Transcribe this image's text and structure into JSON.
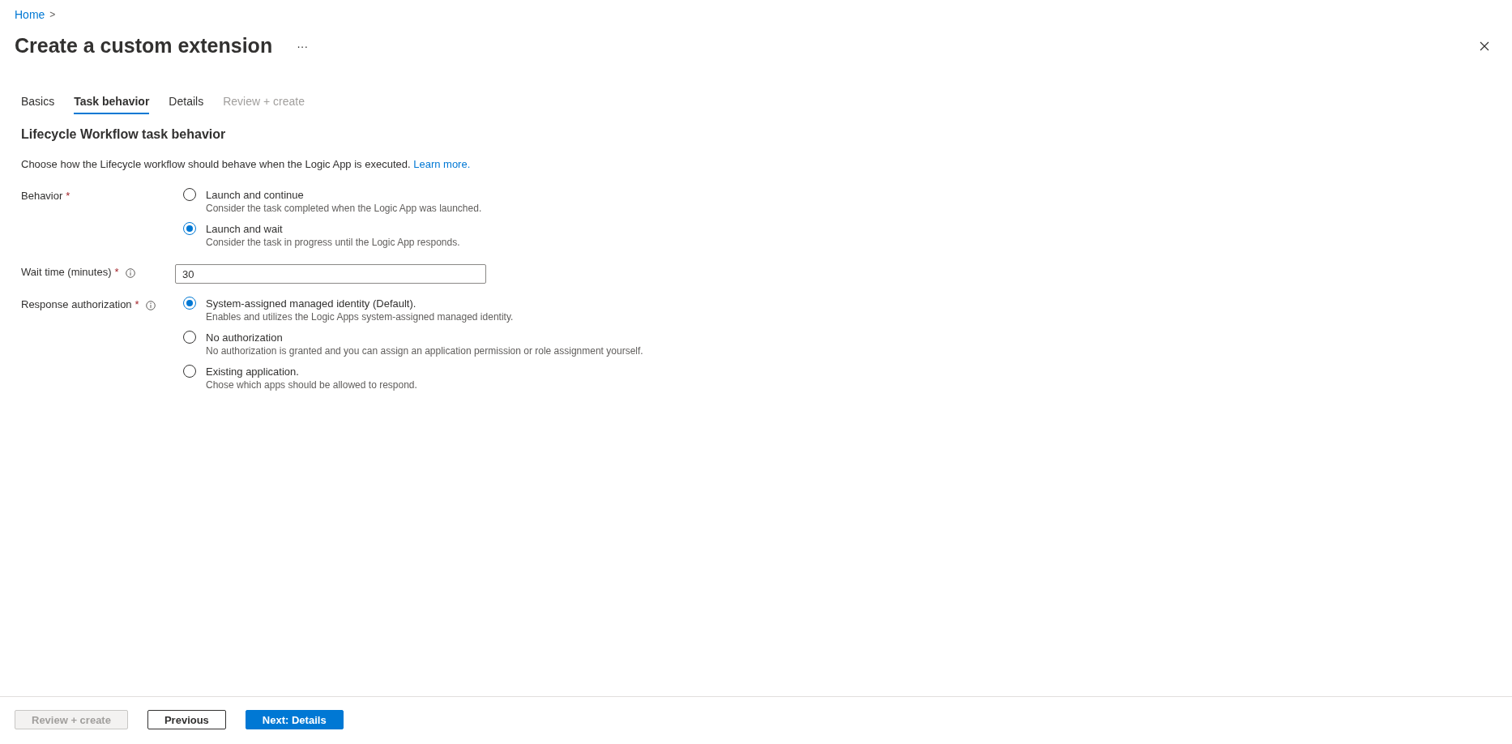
{
  "breadcrumb": {
    "items": [
      "Home"
    ],
    "separator": ">"
  },
  "header": {
    "title": "Create a custom extension",
    "more": "···"
  },
  "tabs": [
    {
      "label": "Basics",
      "selected": false,
      "disabled": false
    },
    {
      "label": "Task behavior",
      "selected": true,
      "disabled": false
    },
    {
      "label": "Details",
      "selected": false,
      "disabled": false
    },
    {
      "label": "Review + create",
      "selected": false,
      "disabled": true
    }
  ],
  "section": {
    "heading": "Lifecycle Workflow task behavior",
    "description": "Choose how the Lifecycle workflow should behave when the Logic App is executed.",
    "link": "Learn more."
  },
  "fields": [
    {
      "kind": "radio",
      "label": "Behavior",
      "required_mark": "*",
      "info": false,
      "options": [
        {
          "label": "Launch and continue",
          "description": "Consider the task completed when the Logic App was launched.",
          "selected": false
        },
        {
          "label": "Launch and wait",
          "description": "Consider the task in progress until the Logic App responds.",
          "selected": true
        }
      ]
    },
    {
      "kind": "input",
      "label": "Wait time (minutes)",
      "required_mark": "*",
      "info": true,
      "value": "30"
    },
    {
      "kind": "radio",
      "label": "Response authorization",
      "required_mark": "*",
      "info": true,
      "options": [
        {
          "label": "System-assigned managed identity (Default).",
          "description": "Enables and utilizes the Logic Apps system-assigned managed identity.",
          "selected": true
        },
        {
          "label": "No authorization",
          "description": "No authorization is granted and you can assign an application permission or role assignment yourself.",
          "selected": false
        },
        {
          "label": "Existing application.",
          "description": "Chose which apps should be allowed to respond.",
          "selected": false
        }
      ]
    }
  ],
  "footer": {
    "buttons": [
      {
        "label": "Review + create",
        "kind": "disabled"
      },
      {
        "label": "Previous",
        "kind": "secondary"
      },
      {
        "label": "Next: Details",
        "kind": "primary"
      }
    ]
  }
}
